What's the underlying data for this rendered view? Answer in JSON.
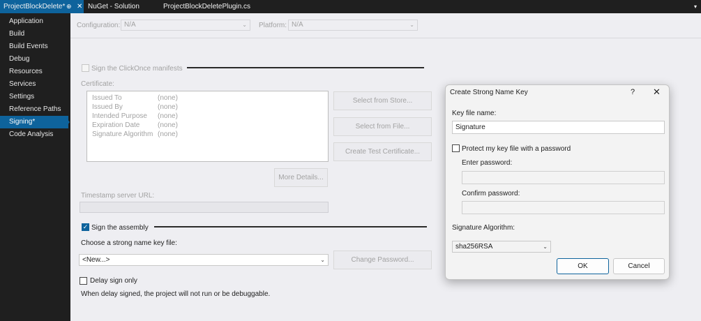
{
  "tabs": [
    {
      "label": "ProjectBlockDelete*",
      "active": true
    },
    {
      "label": "NuGet - Solution",
      "active": false
    },
    {
      "label": "ProjectBlockDeletePlugin.cs",
      "active": false
    }
  ],
  "tab_pin_glyph": "⊕",
  "tab_close_glyph": "✕",
  "tab_dropdown_glyph": "▾",
  "nav": {
    "items": [
      "Application",
      "Build",
      "Build Events",
      "Debug",
      "Resources",
      "Services",
      "Settings",
      "Reference Paths",
      "Signing*",
      "Code Analysis"
    ],
    "active_index": 8
  },
  "config": {
    "configuration_label": "Configuration:",
    "configuration_value": "N/A",
    "platform_label": "Platform:",
    "platform_value": "N/A"
  },
  "clickonce": {
    "checkbox_label": "Sign the ClickOnce manifests",
    "checked": false,
    "certificate_label": "Certificate:",
    "cert_fields": [
      {
        "key": "Issued To",
        "value": "(none)"
      },
      {
        "key": "Issued By",
        "value": "(none)"
      },
      {
        "key": "Intended Purpose",
        "value": "(none)"
      },
      {
        "key": "Expiration Date",
        "value": "(none)"
      },
      {
        "key": "Signature Algorithm",
        "value": "(none)"
      }
    ],
    "select_from_store": "Select from Store...",
    "select_from_file": "Select from File...",
    "create_test_cert": "Create Test Certificate...",
    "more_details": "More Details...",
    "timestamp_label": "Timestamp server URL:",
    "timestamp_value": ""
  },
  "assembly": {
    "checkbox_label": "Sign the assembly",
    "checked": true,
    "choose_label": "Choose a strong name key file:",
    "key_file_value": "<New...>",
    "change_password": "Change Password...",
    "delay_sign_label": "Delay sign only",
    "delay_checked": false,
    "delay_note": "When delay signed, the project will not run or be debuggable."
  },
  "dialog": {
    "title": "Create Strong Name Key",
    "help_glyph": "?",
    "close_glyph": "✕",
    "key_file_name_label": "Key file name:",
    "key_file_name_value": "Signature",
    "protect_label": "Protect my key file with a password",
    "protect_checked": false,
    "enter_password_label": "Enter password:",
    "confirm_password_label": "Confirm password:",
    "algorithm_label": "Signature Algorithm:",
    "algorithm_value": "sha256RSA",
    "ok": "OK",
    "cancel": "Cancel"
  },
  "checkmark_glyph": "✓",
  "caret_glyph": "⌄",
  "colors": {
    "accent": "#0e639c",
    "chrome_dark": "#1f1f1f",
    "panel_bg": "#eeeef2",
    "disabled_text": "#a2a2a2"
  }
}
